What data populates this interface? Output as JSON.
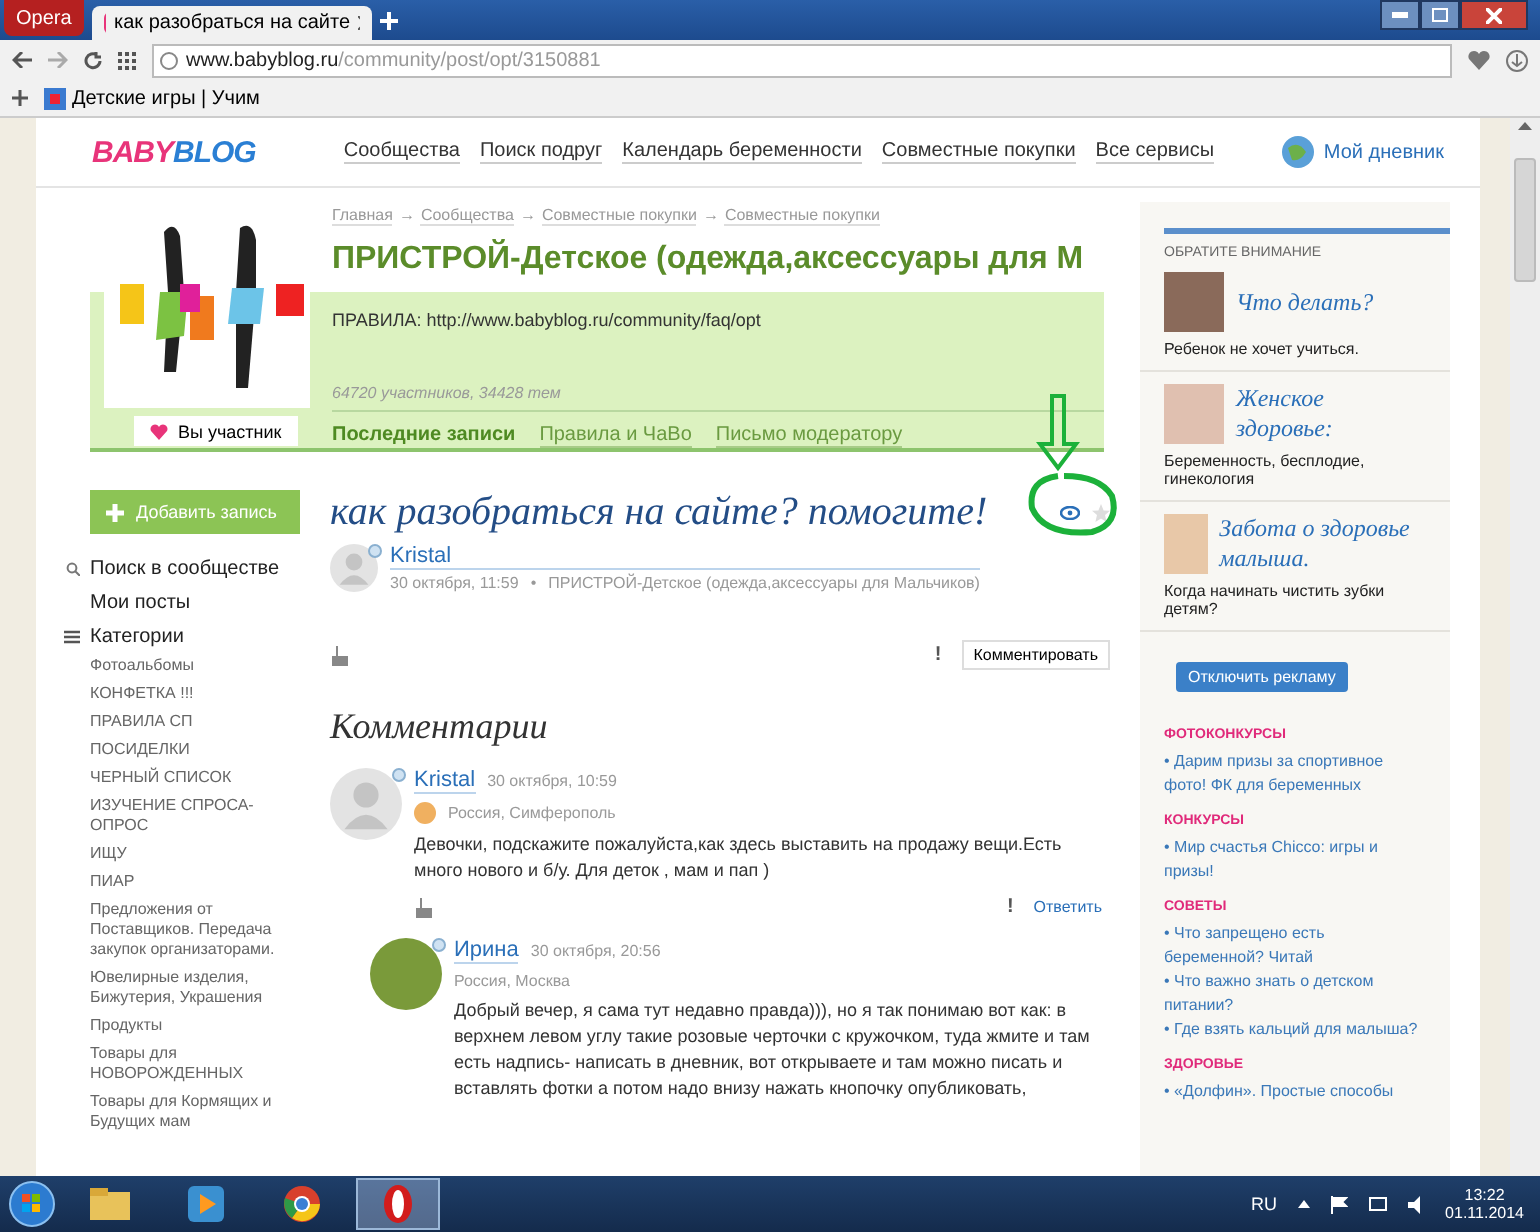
{
  "browser": {
    "menu_label": "Opera",
    "tabs": [
      {
        "title": "как разобраться на сайте",
        "selected": true
      }
    ],
    "url_domain": "www.babyblog.ru",
    "url_path": "/community/post/opt/3150881",
    "bookmarks": [
      "Детские игры | Учим"
    ]
  },
  "site": {
    "logo_pink": "BABY",
    "logo_blue": "BLOG",
    "nav": [
      "Сообщества",
      "Поиск подруг",
      "Календарь беременности",
      "Совместные покупки",
      "Все сервисы"
    ],
    "diary": "Мой дневник"
  },
  "community": {
    "breadcrumbs": [
      "Главная",
      "Сообщества",
      "Совместные покупки",
      "Совместные покупки"
    ],
    "separator": "→",
    "title": "ПРИСТРОЙ-Детское (одежда,аксессуары для М",
    "rules": "ПРАВИЛА: http://www.babyblog.ru/community/faq/opt",
    "stats": "64720 участников, 34428 тем",
    "member_button": "Вы участник",
    "tabs": [
      {
        "label": "Последние записи",
        "selected": true
      },
      {
        "label": "Правила и ЧаВо",
        "selected": false
      },
      {
        "label": "Письмо модератору",
        "selected": false
      }
    ]
  },
  "sidebar": {
    "add_button": "Добавить запись",
    "links": [
      {
        "label": "Поиск в сообществе",
        "kind": "search"
      },
      {
        "label": "Мои посты",
        "kind": "plain"
      },
      {
        "label": "Категории",
        "kind": "menu"
      }
    ],
    "categories": [
      "Фотоальбомы",
      "КОНФЕТКА !!!",
      "ПРАВИЛА СП",
      "ПОСИДЕЛКИ",
      "ЧЕРНЫЙ СПИСОК",
      "ИЗУЧЕНИЕ СПРОСА-ОПРОС",
      "ИЩУ",
      "ПИАР",
      "Предложения от Поставщиков. Передача закупок организаторами.",
      "Ювелирные изделия, Бижутерия, Украшения",
      "Продукты",
      "Товары для НОВОРОЖДЕННЫХ",
      "Товары для Кормящих и Будущих мам"
    ]
  },
  "post": {
    "title": "как разобраться на сайте? помогите!",
    "author": "Kristal",
    "date": "30 октября, 11:59",
    "bullet": "•",
    "community": "ПРИСТРОЙ-Детское (одежда,аксессуары для Мальчиков)",
    "report": "!",
    "comment_button": "Комментировать"
  },
  "comments_heading": "Комментарии",
  "comments": [
    {
      "author": "Kristal",
      "date": "30 октября, 10:59",
      "location": "Россия, Симферополь",
      "text": "Девочки, подскажите пожалуйста,как здесь выставить на продажу вещи.Есть много нового и б/у. Для деток , мам и пап )",
      "report": "!",
      "reply": "Ответить",
      "children": [
        {
          "author": "Ирина",
          "date": "30 октября, 20:56",
          "location": "Россия, Москва",
          "text": "Добрый вечер, я сама тут недавно правда))), но я так понимаю вот как: в верхнем левом углу такие розовые черточки с кружочком, туда жмите и там есть надпись- написать в дневник, вот открываете и там можно писать и вставлять фотки а потом надо внизу нажать кнопочку опубликовать,"
        }
      ]
    }
  ],
  "right": {
    "heading": "ОБРАТИТЕ ВНИМАНИЕ",
    "promos": [
      {
        "title": "Что делать?",
        "text": "Ребенок не хочет учиться."
      },
      {
        "title": "Женское здоровье:",
        "text": "Беременность, бесплодие, гинекология"
      },
      {
        "title": "Забота о здоровье малыша.",
        "text": "Когда начинать чистить зубки детям?"
      }
    ],
    "ad_button": "Отключить рекламу",
    "sections": [
      {
        "title": "ФОТОКОНКУРСЫ",
        "links": [
          "• Дарим призы за спортивное фото! ФК для беременных"
        ]
      },
      {
        "title": "КОНКУРСЫ",
        "links": [
          "• Мир счастья Chicco: игры и призы!"
        ]
      },
      {
        "title": "СОВЕТЫ",
        "links": [
          "• Что запрещено есть беременной? Читай",
          "• Что важно знать о детском питании?",
          "• Где взять кальций для малыша?"
        ]
      },
      {
        "title": "ЗДОРОВЬЕ",
        "links": [
          "• «Долфин». Простые способы"
        ]
      }
    ]
  },
  "taskbar": {
    "apps": [
      {
        "kind": "folder",
        "selected": false
      },
      {
        "kind": "media",
        "selected": false
      },
      {
        "kind": "chrome",
        "selected": false
      },
      {
        "kind": "opera",
        "selected": true
      }
    ],
    "language": "RU",
    "time": "13:22",
    "date": "01.11.2014"
  }
}
